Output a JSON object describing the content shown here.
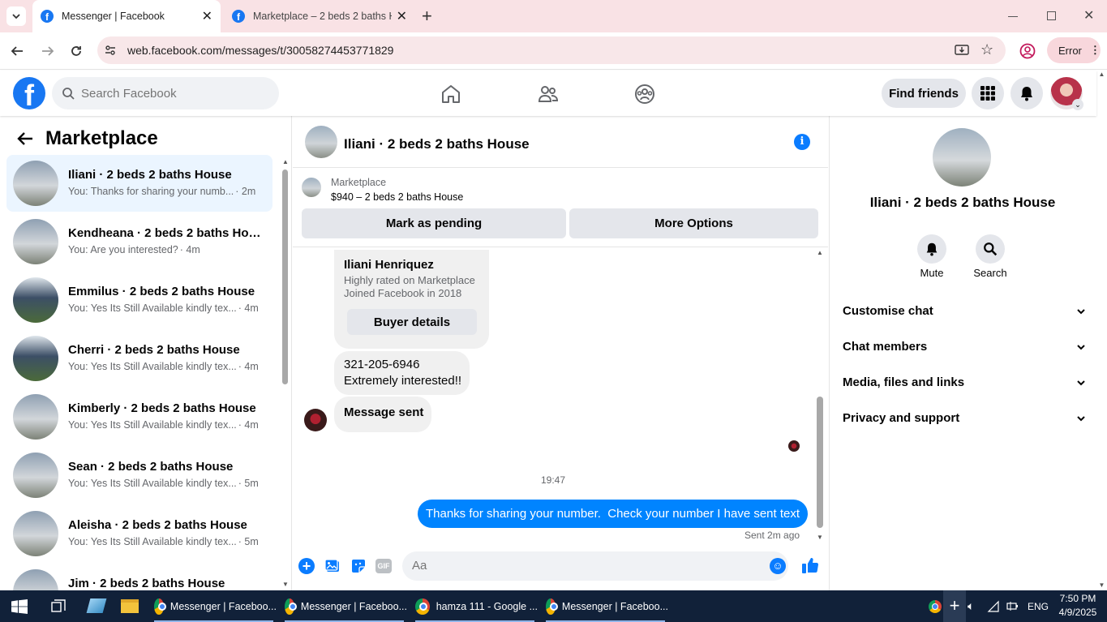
{
  "browser": {
    "tabs": [
      {
        "title": "Messenger | Facebook",
        "active": true
      },
      {
        "title": "Marketplace – 2 beds 2 baths H",
        "active": false
      }
    ],
    "url": "web.facebook.com/messages/t/30058274453771829",
    "error_label": "Error"
  },
  "fb": {
    "search_placeholder": "Search Facebook",
    "find_friends": "Find friends"
  },
  "sidebar": {
    "title": "Marketplace",
    "conversations": [
      {
        "name": "Iliani · 2 beds 2 baths House",
        "preview": "You: Thanks for sharing your numb...",
        "time": "· 2m",
        "selected": true
      },
      {
        "name": "Kendheana · 2 beds 2 baths Hou...",
        "preview": "You: Are you interested?",
        "time": "· 4m"
      },
      {
        "name": "Emmilus · 2 beds 2 baths House",
        "preview": "You: Yes Its Still Available kindly tex...",
        "time": "· 4m"
      },
      {
        "name": "Cherri · 2 beds 2 baths House",
        "preview": "You: Yes Its Still Available kindly tex...",
        "time": "· 4m"
      },
      {
        "name": "Kimberly · 2 beds 2 baths House",
        "preview": "You: Yes Its Still Available kindly tex...",
        "time": "· 4m"
      },
      {
        "name": "Sean · 2 beds 2 baths House",
        "preview": "You: Yes Its Still Available kindly tex...",
        "time": "· 5m"
      },
      {
        "name": "Aleisha · 2 beds 2 baths House",
        "preview": "You: Yes Its Still Available kindly tex...",
        "time": "· 5m"
      },
      {
        "name": "Jim · 2 beds 2 baths House",
        "preview": "",
        "time": ""
      }
    ]
  },
  "chat": {
    "title": "Iliani · 2 beds 2 baths House",
    "listing": {
      "source": "Marketplace",
      "summary": "$940 – 2 beds 2 baths House"
    },
    "mark_pending": "Mark as pending",
    "more_options": "More Options",
    "buyer": {
      "name": "Iliani Henriquez",
      "line1": "Highly rated on Marketplace",
      "line2": "Joined Facebook in 2018",
      "details_btn": "Buyer details"
    },
    "msg_phone": "321-205-6946",
    "msg_interest": "Extremely interested!!",
    "msg_sent_text": "Message sent",
    "time_divider": "19:47",
    "outgoing": "Thanks for sharing your number.  Check your number I have sent text",
    "sent_status": "Sent 2m ago",
    "composer_placeholder": "Aa"
  },
  "right_panel": {
    "name": "Iliani · 2 beds 2 baths House",
    "mute": "Mute",
    "search": "Search",
    "sections": [
      "Customise chat",
      "Chat members",
      "Media, files and links",
      "Privacy and support"
    ]
  },
  "taskbar": {
    "apps": [
      "Messenger | Faceboo...",
      "Messenger | Faceboo...",
      "hamza 111 - Google ...",
      "Messenger | Faceboo..."
    ],
    "lang": "ENG",
    "time": "7:50 PM",
    "date": "4/9/2025"
  },
  "colors": {
    "accent": "#0084ff",
    "fb_blue": "#1877f2",
    "tab_strip": "#f9e2e5",
    "taskbar": "#112139"
  }
}
